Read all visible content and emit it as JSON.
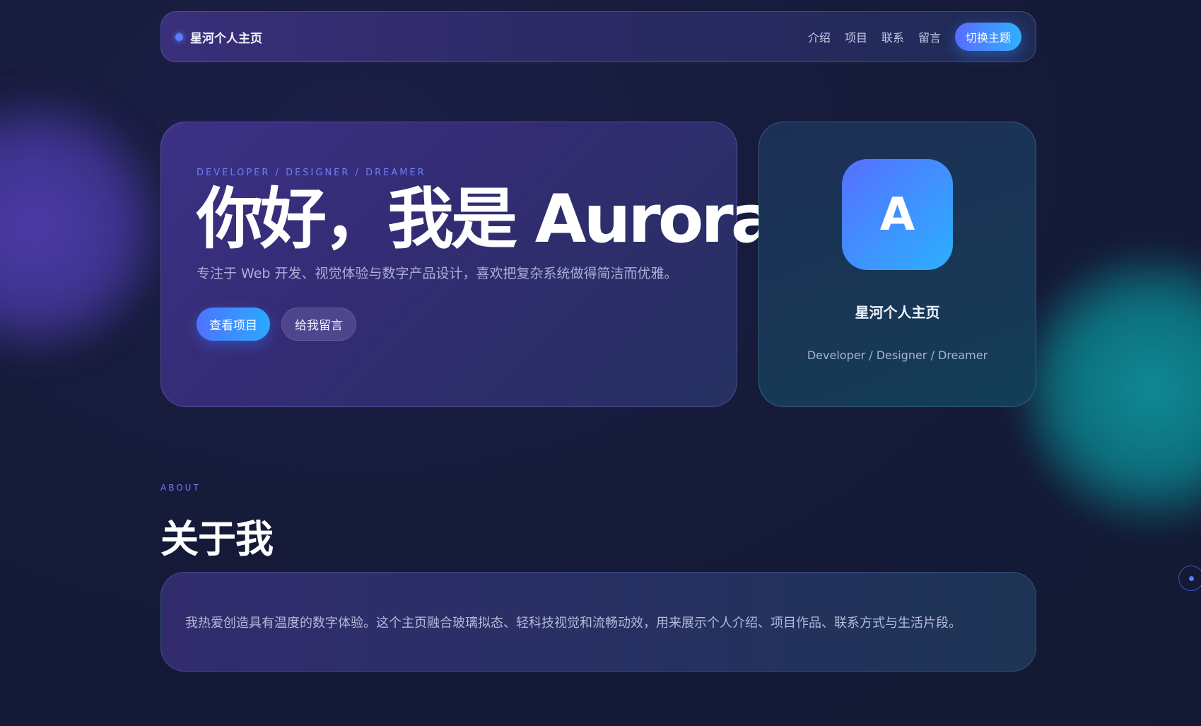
{
  "nav": {
    "brand": "星河个人主页",
    "links": [
      "介绍",
      "项目",
      "联系",
      "留言"
    ],
    "theme_button": "切换主题"
  },
  "hero": {
    "eyebrow": "DEVELOPER / DESIGNER / DREAMER",
    "title": "你好，我是 Aurora",
    "subtitle": "专注于 Web 开发、视觉体验与数字产品设计，喜欢把复杂系统做得简洁而优雅。",
    "primary_button": "查看项目",
    "secondary_button": "给我留言"
  },
  "profile": {
    "avatar_letter": "A",
    "name": "星河个人主页",
    "tagline": "Developer / Designer / Dreamer"
  },
  "about": {
    "eyebrow": "ABOUT",
    "title": "关于我",
    "text": "我热爱创造具有温度的数字体验。这个主页融合玻璃拟态、轻科技视觉和流畅动效，用来展示个人介绍、项目作品、联系方式与生活片段。"
  },
  "colors": {
    "accent_start": "#5a6cff",
    "accent_end": "#2fb0ff",
    "background": "#131b36"
  }
}
